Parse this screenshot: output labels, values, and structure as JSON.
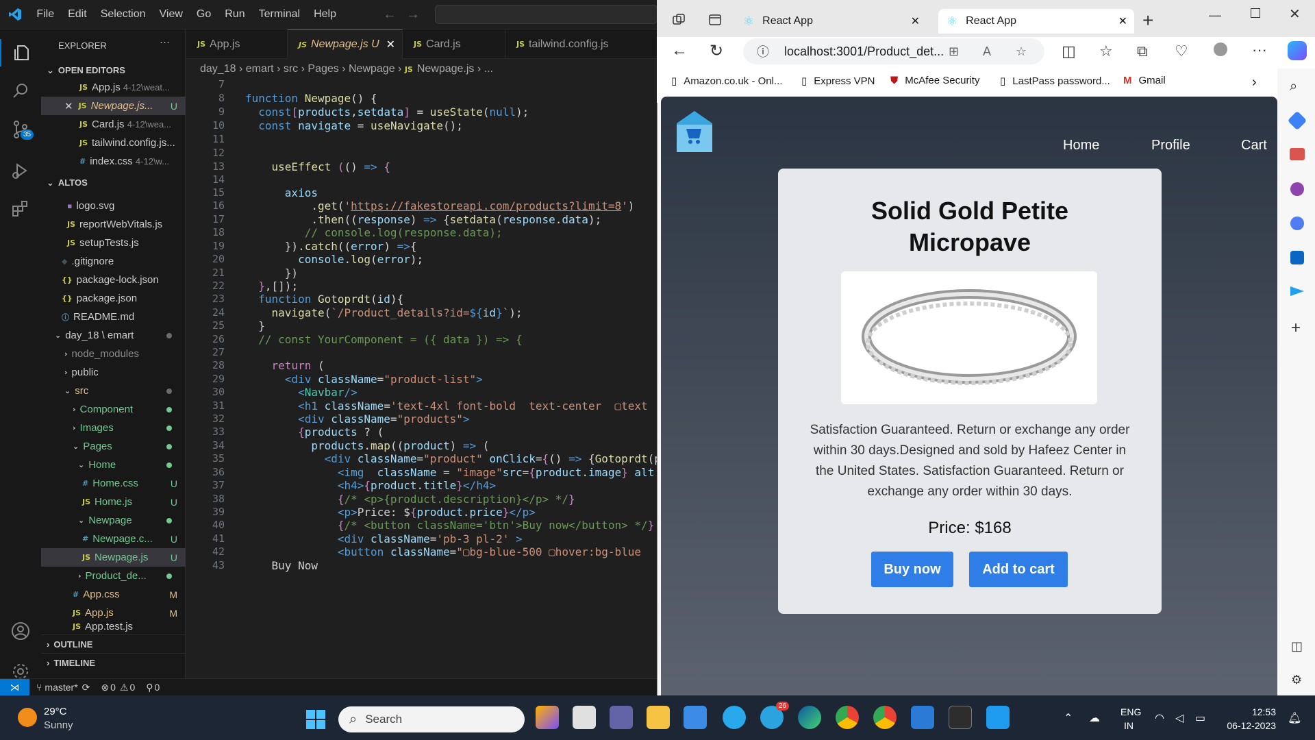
{
  "vscode": {
    "menu": [
      "File",
      "Edit",
      "Selection",
      "View",
      "Go",
      "Run",
      "Terminal",
      "Help"
    ],
    "scm_badge": "35",
    "explorer_title": "EXPLORER",
    "explorer_more": "···",
    "open_editors_title": "OPEN EDITORS",
    "open_editors": [
      {
        "icon": "JS",
        "name": "App.js",
        "path": "4-12\\weat..."
      },
      {
        "icon": "JS",
        "name": "Newpage.js...",
        "path": "",
        "status": "U",
        "close": "✕"
      },
      {
        "icon": "JS",
        "name": "Card.js",
        "path": "4-12\\wea..."
      },
      {
        "icon": "JS",
        "name": "tailwind.config.js..."
      },
      {
        "icon": "#",
        "name": "index.css",
        "path": "4-12\\w..."
      }
    ],
    "project_title": "ALTOS",
    "tree": [
      {
        "icon": "▪",
        "name": "logo.svg"
      },
      {
        "icon": "JS",
        "name": "reportWebVitals.js"
      },
      {
        "icon": "JS",
        "name": "setupTests.js"
      },
      {
        "icon": "◆",
        "name": ".gitignore"
      },
      {
        "icon": "{}",
        "name": "package-lock.json"
      },
      {
        "icon": "{}",
        "name": "package.json"
      },
      {
        "icon": "ⓘ",
        "name": "README.md"
      },
      {
        "icon": "⌄",
        "name": "day_18 \\ emart"
      },
      {
        "icon": "›",
        "name": "node_modules"
      },
      {
        "icon": "›",
        "name": "public"
      },
      {
        "icon": "⌄",
        "name": "src"
      },
      {
        "icon": "›",
        "name": "Component"
      },
      {
        "icon": "›",
        "name": "Images"
      },
      {
        "icon": "⌄",
        "name": "Pages"
      },
      {
        "icon": "⌄",
        "name": "Home"
      },
      {
        "icon": "#",
        "name": "Home.css",
        "status": "U"
      },
      {
        "icon": "JS",
        "name": "Home.js",
        "status": "U"
      },
      {
        "icon": "⌄",
        "name": "Newpage"
      },
      {
        "icon": "#",
        "name": "Newpage.c...",
        "status": "U"
      },
      {
        "icon": "JS",
        "name": "Newpage.js",
        "status": "U"
      },
      {
        "icon": "›",
        "name": "Product_de..."
      },
      {
        "icon": "#",
        "name": "App.css",
        "status": "M"
      },
      {
        "icon": "JS",
        "name": "App.js",
        "status": "M"
      },
      {
        "icon": "JS",
        "name": "App.test.js"
      }
    ],
    "outline_title": "OUTLINE",
    "timeline_title": "TIMELINE",
    "tabs": [
      {
        "icon": "JS",
        "name": "App.js"
      },
      {
        "icon": "JS",
        "name": "Newpage.js",
        "status": "U",
        "close": "✕"
      },
      {
        "icon": "JS",
        "name": "Card.js"
      },
      {
        "icon": "JS",
        "name": "tailwind.config.js"
      }
    ],
    "breadcrumb": [
      "day_18",
      "emart",
      "src",
      "Pages",
      "Newpage",
      "Newpage.js",
      "..."
    ],
    "line_numbers": [
      "7",
      "8",
      "9",
      "10",
      "11",
      "12",
      "13",
      "14",
      "15",
      "16",
      "17",
      "18",
      "19",
      "20",
      "21",
      "22",
      "23",
      "24",
      "25",
      "26",
      "27",
      "28",
      "29",
      "30",
      "31",
      "32",
      "33",
      "34",
      "35",
      "36",
      "37",
      "38",
      "39",
      "40",
      "41",
      "42",
      "43"
    ],
    "status": {
      "branch": "master*",
      "errors": "0",
      "warnings": "0",
      "ports": "0"
    }
  },
  "browser": {
    "tabs": [
      {
        "title": "React App",
        "close": "✕"
      },
      {
        "title": "React App",
        "close": "✕"
      }
    ],
    "new_tab": "+",
    "url": "localhost:3001/Product_det...",
    "bookmarks": [
      "Amazon.co.uk - Onl...",
      "Express VPN",
      "McAfee Security",
      "LastPass password...",
      "Gmail"
    ],
    "nav": {
      "home": "Home",
      "profile": "Profile",
      "cart": "Cart"
    },
    "product": {
      "title_line1": "Solid Gold Petite",
      "title_line2": "Micropave",
      "desc": "Satisfaction Guaranteed. Return or exchange any order within 30 days.Designed and sold by Hafeez Center in the United States. Satisfaction Guaranteed. Return or exchange any order within 30 days.",
      "price": "Price: $168",
      "buy": "Buy now",
      "add": "Add to cart"
    }
  },
  "taskbar": {
    "temp": "29°C",
    "weather": "Sunny",
    "search": "Search",
    "telegram_badge": "26",
    "lang": "ENG",
    "region": "IN",
    "time": "12:53",
    "date": "06-12-2023"
  }
}
